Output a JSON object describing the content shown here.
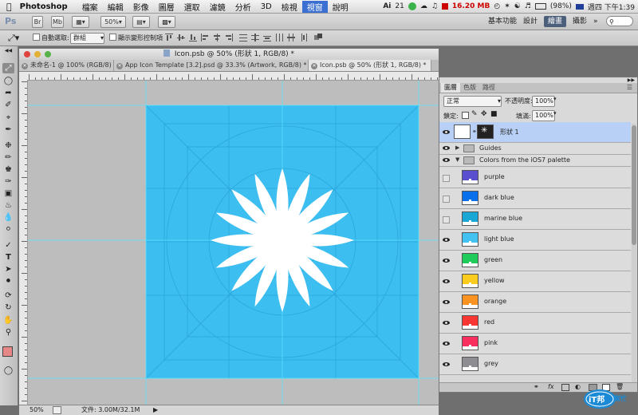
{
  "menubar": {
    "items": [
      "Photoshop",
      "檔案",
      "編輯",
      "影像",
      "圖層",
      "選取",
      "濾鏡",
      "分析",
      "3D",
      "檢視",
      "視窗",
      "說明"
    ],
    "active_index": 10,
    "status": {
      "ai": "21",
      "memory": "16.20 MB",
      "battery": "(98%)",
      "clock": "週四 下午1:39"
    }
  },
  "appbar": {
    "logo": "Ps",
    "br": "Br",
    "mb": "Mb",
    "zoom": "50%",
    "workspaces": [
      "基本功能",
      "設計",
      "繪畫",
      "攝影"
    ],
    "active_workspace": "繪畫"
  },
  "options": {
    "auto_select_label": "自動選取:",
    "auto_select_value": "群組",
    "show_transform_label": "顯示變形控制項"
  },
  "document": {
    "title": "Icon.psb @ 50% (形狀 1, RGB/8) *",
    "tabs": [
      {
        "label": "未命名-1 @ 100% (RGB/8)",
        "active": false
      },
      {
        "label": "App Icon Template [3.2].psd @ 33.3% (Artwork, RGB/8) *",
        "active": false
      },
      {
        "label": "Icon.psb @ 50% (形狀 1, RGB/8) *",
        "active": true
      }
    ],
    "status_zoom": "50%",
    "status_file": "文件: 3.00M/32.1M"
  },
  "colors": {
    "icon_bg": "#3dbef0",
    "guide": "#5be4ff",
    "foreground": "#e68888"
  },
  "layers_panel": {
    "tabs": [
      "圖層",
      "色版",
      "路徑"
    ],
    "blend_mode": "正常",
    "opacity_label": "不透明度:",
    "opacity_value": "100%",
    "lock_label": "鎖定:",
    "fill_label": "填滿:",
    "fill_value": "100%",
    "layers": [
      {
        "name": "形狀 1",
        "visible": true,
        "selected": true,
        "kind": "shape"
      },
      {
        "name": "Guides",
        "visible": true,
        "kind": "folder",
        "expanded": false
      },
      {
        "name": "Colors from the iOS7 palette",
        "visible": true,
        "kind": "folder",
        "expanded": true
      },
      {
        "name": "purple",
        "visible": false,
        "color": "#5a4fcf"
      },
      {
        "name": "dark blue",
        "visible": false,
        "color": "#0a6fea"
      },
      {
        "name": "marine blue",
        "visible": false,
        "color": "#1ba7d6"
      },
      {
        "name": "light blue",
        "visible": true,
        "color": "#43c2f2"
      },
      {
        "name": "green",
        "visible": true,
        "color": "#1fcb5a"
      },
      {
        "name": "yellow",
        "visible": true,
        "color": "#fbcb1e"
      },
      {
        "name": "orange",
        "visible": true,
        "color": "#fb9322"
      },
      {
        "name": "red",
        "visible": true,
        "color": "#f83633"
      },
      {
        "name": "pink",
        "visible": true,
        "color": "#f82f5e"
      },
      {
        "name": "grey",
        "visible": true,
        "color": "#8d8d92"
      }
    ]
  },
  "watermark": {
    "line1": "iT邦",
    "line2": "幫忙"
  }
}
